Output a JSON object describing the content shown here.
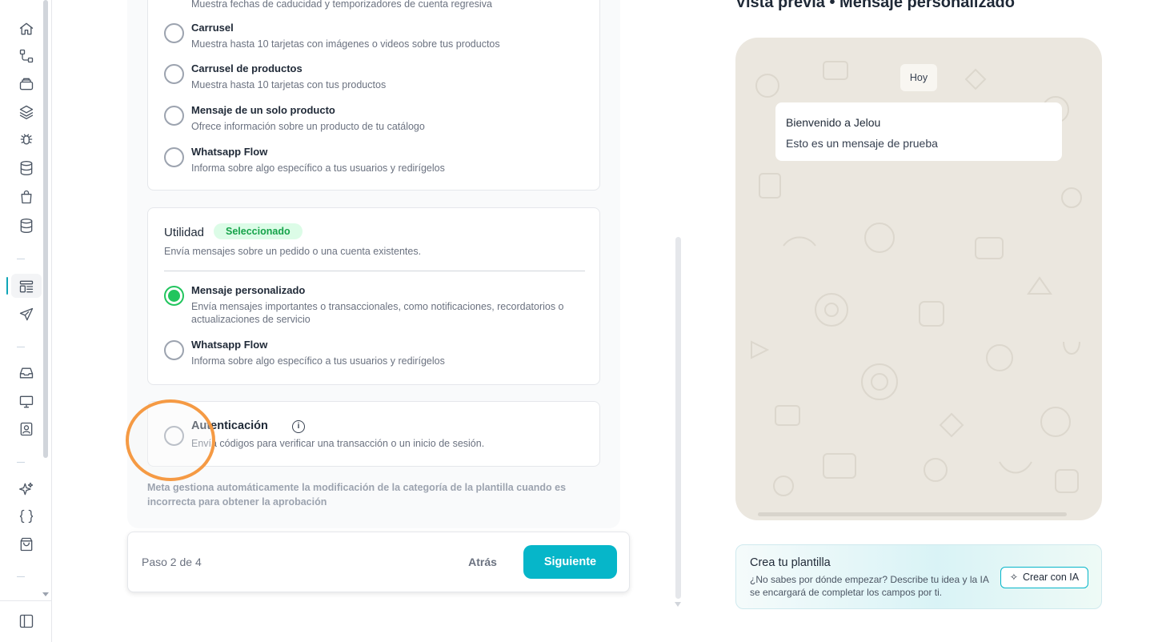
{
  "sidebar": {
    "icons": [
      "home-icon",
      "flow-icon",
      "archive-icon",
      "layers-icon",
      "bug-icon",
      "database-icon",
      "shopping-bag-icon",
      "database-stack-icon",
      "templates-icon",
      "send-icon",
      "inbox-icon",
      "monitor-icon",
      "contacts-icon",
      "sparkles-icon",
      "code-braces-icon",
      "shopping-bag-alt-icon",
      "sidebar-toggle-icon"
    ]
  },
  "marketing": {
    "top_desc_partial": "Muestra fechas de caducidad y temporizadores de cuenta regresiva",
    "options": [
      {
        "title": "Carrusel",
        "desc": "Muestra hasta 10 tarjetas con imágenes o videos sobre tus productos"
      },
      {
        "title": "Carrusel de productos",
        "desc": "Muestra hasta 10 tarjetas con tus productos"
      },
      {
        "title": "Mensaje de un solo producto",
        "desc": "Ofrece información sobre un producto de tu catálogo"
      },
      {
        "title": "Whatsapp Flow",
        "desc": "Informa sobre algo específico a tus usuarios y redirígelos"
      }
    ]
  },
  "utility": {
    "title": "Utilidad",
    "badge": "Seleccionado",
    "desc": "Envía mensajes sobre un pedido o una cuenta existentes.",
    "options": [
      {
        "title": "Mensaje personalizado",
        "desc": "Envía mensajes importantes o transaccionales, como notificaciones, recordatorios o actualizaciones de servicio",
        "selected": true
      },
      {
        "title": "Whatsapp Flow",
        "desc": "Informa sobre algo específico a tus usuarios y redirígelos",
        "selected": false
      }
    ]
  },
  "auth": {
    "title": "Autenticación",
    "desc": "Envía códigos para verificar una transacción o un inicio de sesión."
  },
  "meta_note": "Meta gestiona automáticamente la modificación de la categoría de la plantilla cuando es incorrecta para obtener la aprobación",
  "footer": {
    "step": "Paso 2 de 4",
    "back": "Atrás",
    "next": "Siguiente"
  },
  "preview": {
    "title": "Vista previa • Mensaje personalizado",
    "day_chip": "Hoy",
    "message_title": "Bienvenido a Jelou",
    "message_body": "Esto es un mensaje de prueba"
  },
  "ai_card": {
    "title": "Crea tu plantilla",
    "desc": "¿No sabes por dónde empezar? Describe tu idea y la IA se encargará de completar los campos por ti.",
    "button": "Crear con IA"
  },
  "colors": {
    "accent": "#06b6c9",
    "selected_green": "#22c55e",
    "badge_bg": "#dcfce7",
    "highlight_orange": "#f59a44",
    "chat_bg": "#ebe7df"
  }
}
